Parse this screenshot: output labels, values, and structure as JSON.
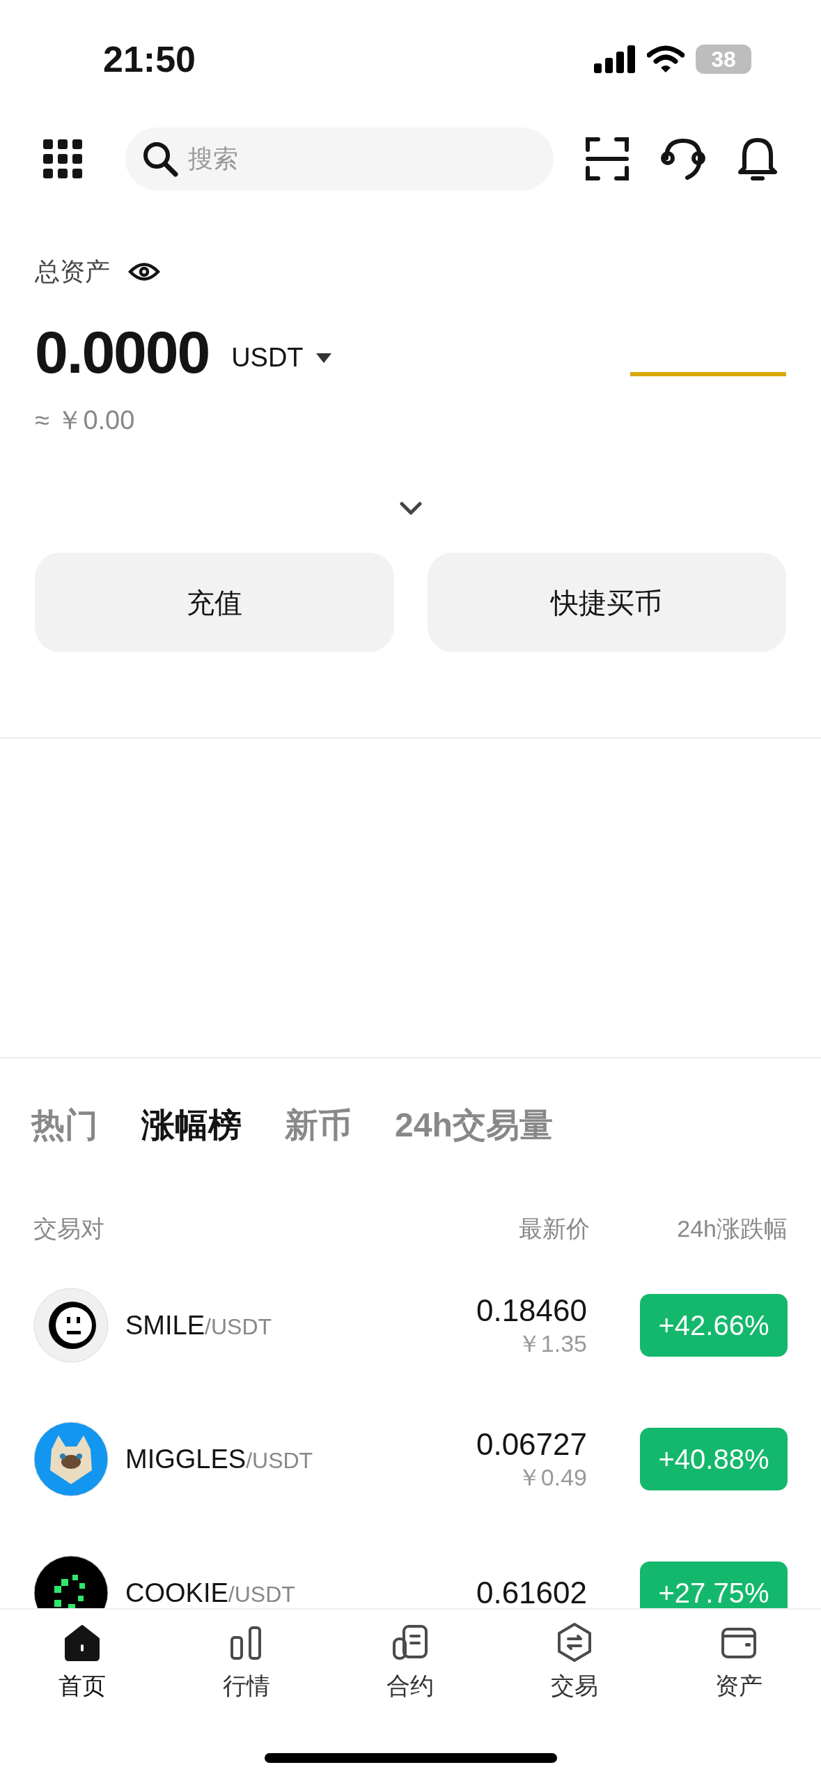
{
  "status_bar": {
    "time": "21:50",
    "battery": "38"
  },
  "header": {
    "search": {
      "placeholder": "搜索"
    }
  },
  "balance": {
    "label": "总资产",
    "amount": "0.0000",
    "currency": "USDT",
    "approx": "≈ ￥0.00"
  },
  "actions": [
    "充值",
    "快捷买币"
  ],
  "tabs": [
    {
      "label": "热门",
      "selected": false
    },
    {
      "label": "涨幅榜",
      "selected": true
    },
    {
      "label": "新币",
      "selected": false
    },
    {
      "label": "24h交易量",
      "selected": false
    }
  ],
  "table": {
    "columns": [
      "交易对",
      "最新价",
      "24h涨跌幅"
    ],
    "rows": [
      {
        "base": "SMILE",
        "quote": "/USDT",
        "price": "0.18460",
        "cny": "￥1.35",
        "change": "+42.66%",
        "color": "#f0f0f0"
      },
      {
        "base": "MIGGLES",
        "quote": "/USDT",
        "price": "0.06727",
        "cny": "￥0.49",
        "change": "+40.88%",
        "color": "#1296f0"
      },
      {
        "base": "COOKIE",
        "quote": "/USDT",
        "price": "0.61602",
        "change": "+27.75%",
        "color": "#000000"
      }
    ]
  },
  "nav": [
    {
      "label": "首页",
      "selected": true
    },
    {
      "label": "行情",
      "selected": false
    },
    {
      "label": "合约",
      "selected": false
    },
    {
      "label": "交易",
      "selected": false
    },
    {
      "label": "资产",
      "selected": false
    }
  ]
}
